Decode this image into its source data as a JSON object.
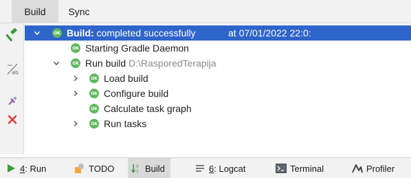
{
  "tabs": [
    {
      "label": "Build",
      "active": true
    },
    {
      "label": "Sync",
      "active": false
    }
  ],
  "left_toolbar": {
    "icons": [
      "hammer-icon",
      "soft-wrap-icon",
      "pin-icon",
      "close-icon"
    ]
  },
  "tree": {
    "rows": [
      {
        "prefix": "Build:",
        "text": " completed successfully",
        "time": "at 07/01/2022 22:0:",
        "status": "OK",
        "expanded": true,
        "selected": true
      },
      {
        "text": "Starting Gradle Daemon",
        "status": "OK"
      },
      {
        "text": "Run build",
        "path": "D:\\RasporedTerapija",
        "status": "OK",
        "expanded": true
      },
      {
        "text": "Load build",
        "status": "OK",
        "expanded": false
      },
      {
        "text": "Configure build",
        "status": "OK",
        "expanded": false
      },
      {
        "text": "Calculate task graph",
        "status": "OK"
      },
      {
        "text": "Run tasks",
        "status": "OK",
        "expanded": false
      }
    ]
  },
  "bottom_tabs": [
    {
      "key": "4",
      "label": ": Run",
      "icon": "run-icon",
      "active": false
    },
    {
      "label": "TODO",
      "icon": "todo-icon",
      "active": false
    },
    {
      "label": "Build",
      "icon": "build-icon",
      "active": true
    },
    {
      "key": "6",
      "label": ": Logcat",
      "icon": "logcat-icon",
      "active": false
    },
    {
      "label": "Terminal",
      "icon": "terminal-icon",
      "active": false
    },
    {
      "label": "Profiler",
      "icon": "profiler-icon",
      "active": false
    }
  ],
  "colors": {
    "selection": "#2f65ca",
    "ok_badge": "#5fb85f",
    "hammer": "#3c9a3c",
    "close": "#d93a3a"
  }
}
